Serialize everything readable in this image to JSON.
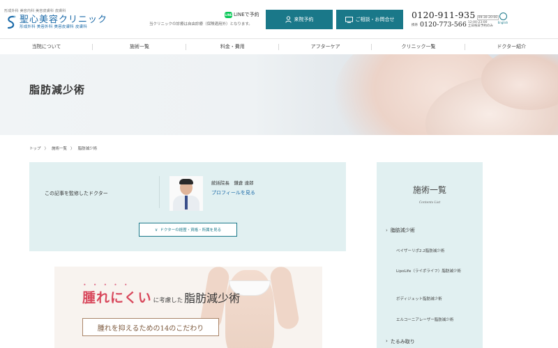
{
  "header": {
    "brand_tag": "形成外科 美容内科 美容皮膚科 皮膚科",
    "logo_name": "聖心美容クリニック",
    "logo_sub": "形成外科  美容外科  美容皮膚科  皮膚科",
    "line_label": "LINEで予約",
    "line_icon_text": "LINE",
    "insurance_note": "当クリニックの診療は自由診療（保険適用外）となります。",
    "visit_button": "来院予約",
    "contact_button": "ご相談・お問合せ",
    "phone_main": "0120-911-935",
    "phone_main_hours": "09:30-20:00",
    "phone_sub_label": "携帯",
    "phone_sub": "0120-773-566",
    "phone_sub_hours": "12:00-23:00",
    "phone_sub_note": "土日祝日予約のみ",
    "lang_label": "English"
  },
  "nav": {
    "items": [
      "当院について",
      "施術一覧",
      "料金・費用",
      "アフターケア",
      "クリニック一覧",
      "ドクター紹介"
    ]
  },
  "hero": {
    "title": "脂肪減少術"
  },
  "breadcrumb": {
    "home": "トップ",
    "sep": "〉",
    "parent": "施術一覧",
    "current": "脂肪減少術"
  },
  "supervisor": {
    "label": "この記事を監修したドクター",
    "doctor_name": "統括院長　鎌倉 達郎",
    "profile_link": "プロフィールを見る",
    "career_button": "ドクターの経歴・資格・所属を見る",
    "career_chev": "∨"
  },
  "banner": {
    "dots": "•••••",
    "title_emphasis": "腫れにくい",
    "title_connector": "に考慮した",
    "title_main": "脂肪減少術",
    "sub": "腫れを抑えるための14のこだわり"
  },
  "sidebar": {
    "title": "施術一覧",
    "subtitle": "Contents List",
    "main_item": "脂肪減少術",
    "sub_items": [
      "ベイザーリポ2.2脂肪減少術",
      "LipoLife（ライポライフ）脂肪減少術",
      "ボディジェット脂肪減少術",
      "エルコーニアレーザー脂肪減少術"
    ],
    "next_item": "たるみ取り",
    "arrow": "›"
  },
  "colors": {
    "accent": "#1a7889",
    "link": "#1b6aa8",
    "panel_bg": "#e1f0f1",
    "banner_red": "#d8485c",
    "line_green": "#06c755"
  }
}
